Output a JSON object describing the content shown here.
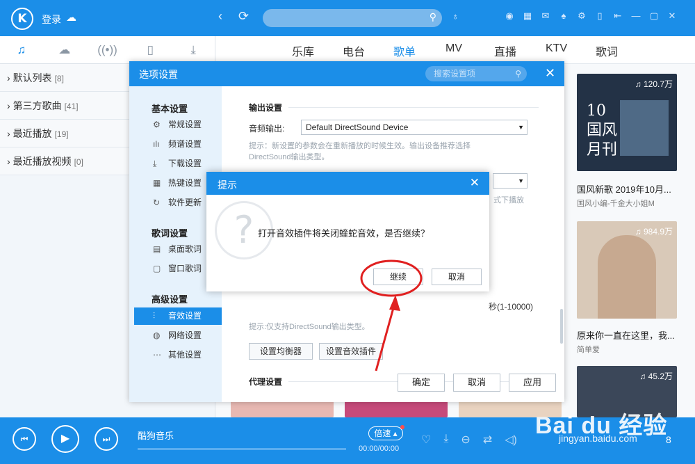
{
  "topbar": {
    "logo": "K",
    "login": "登录",
    "back_glyph": "‹",
    "refresh_glyph": "⟳"
  },
  "left": {
    "tabs": [
      "♫",
      "☁",
      "((•))",
      "▯",
      "⤓"
    ],
    "lists": [
      {
        "name": "默认列表",
        "count": "[8]"
      },
      {
        "name": "第三方歌曲",
        "count": "[41]"
      },
      {
        "name": "最近播放",
        "count": "[19]"
      },
      {
        "name": "最近播放视频",
        "count": "[0]"
      }
    ]
  },
  "categories": [
    "乐库",
    "电台",
    "歌单",
    "MV",
    "直播",
    "KTV",
    "歌词"
  ],
  "albums": [
    {
      "count": "120.7万",
      "art_text": "10\n国风\n月刊",
      "title": "国风新歌 2019年10月...",
      "sub": "国风小编-千金大小姐M"
    },
    {
      "count": "984.9万",
      "title": "原来你一直在这里，我...",
      "sub": "简单爱"
    },
    {
      "count": "45.2万"
    }
  ],
  "options": {
    "title": "选项设置",
    "search_placeholder": "搜索设置项",
    "groups": [
      {
        "title": "基本设置",
        "items": [
          {
            "icon": "⚙",
            "label": "常规设置"
          },
          {
            "icon": "ılı",
            "label": "频谱设置"
          },
          {
            "icon": "⤓",
            "label": "下载设置"
          },
          {
            "icon": "▦",
            "label": "热键设置"
          },
          {
            "icon": "↻",
            "label": "软件更新"
          }
        ]
      },
      {
        "title": "歌词设置",
        "items": [
          {
            "icon": "▤",
            "label": "桌面歌词"
          },
          {
            "icon": "▢",
            "label": "窗口歌词"
          }
        ]
      },
      {
        "title": "高级设置",
        "items": [
          {
            "icon": "⫶",
            "label": "音效设置"
          },
          {
            "icon": "◍",
            "label": "网络设置"
          },
          {
            "icon": "⋯",
            "label": "其他设置"
          }
        ]
      }
    ],
    "output_section": "输出设置",
    "audio_output_label": "音频输出:",
    "audio_output_value": "Default DirectSound Device",
    "hint1_line1": "提示：新设置的参数会在重新播放的时候生效。输出设备推荐选择",
    "hint1_line2": "DirectSound输出类型。",
    "partial_hint": "式下播放",
    "partial_range": "秒(1-10000)",
    "hint2": "提示:仅支持DirectSound输出类型。",
    "eq_button": "设置均衡器",
    "plugin_button": "设置音效插件",
    "proxy_section": "代理设置",
    "ok": "确定",
    "cancel": "取消",
    "apply": "应用"
  },
  "prompt": {
    "title": "提示",
    "message": "打开音效插件将关闭蝰蛇音效，是否继续？",
    "continue": "继续",
    "cancel": "取消"
  },
  "player": {
    "song": "酷狗音乐",
    "speed": "倍速",
    "time": "00:00/00:00",
    "page": "8"
  },
  "watermark": {
    "brand": "Bai du 经验",
    "url": "jingyan.baidu.com"
  },
  "colors": {
    "accent": "#1b8ee8",
    "annotation": "#e02020"
  }
}
